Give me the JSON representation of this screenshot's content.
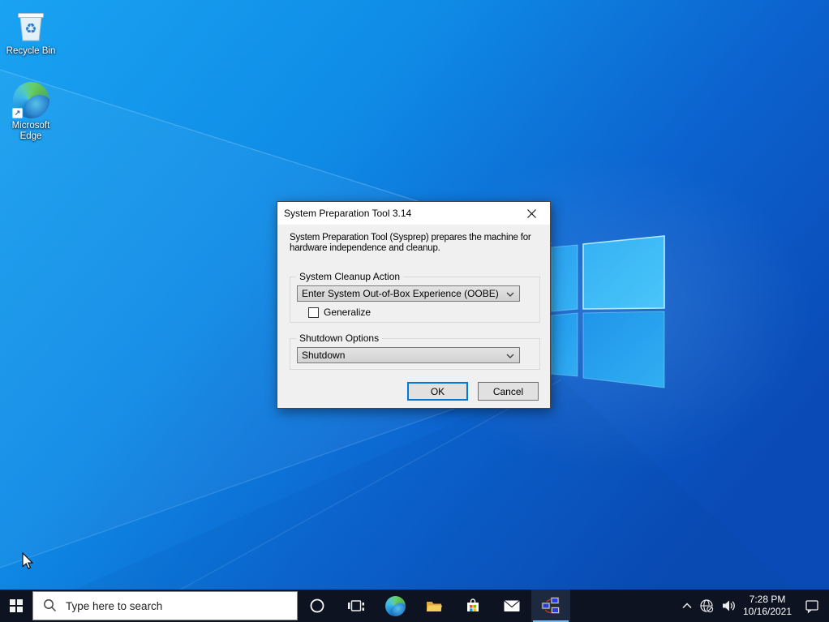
{
  "desktop": {
    "icons": [
      {
        "label": "Recycle Bin"
      },
      {
        "label": "Microsoft Edge"
      }
    ]
  },
  "dialog": {
    "title": "System Preparation Tool 3.14",
    "description_line1": "System Preparation Tool (Sysprep) prepares the machine for",
    "description_line2": "hardware independence and cleanup.",
    "cleanup_group": {
      "label": "System Cleanup Action",
      "dropdown_value": "Enter System Out-of-Box Experience (OOBE)",
      "checkbox_label": "Generalize",
      "checkbox_checked": false
    },
    "shutdown_group": {
      "label": "Shutdown Options",
      "dropdown_value": "Shutdown"
    },
    "buttons": {
      "ok": "OK",
      "cancel": "Cancel"
    }
  },
  "taskbar": {
    "search": {
      "placeholder": "Type here to search"
    },
    "apps": [
      {
        "name": "cortana"
      },
      {
        "name": "task-view"
      },
      {
        "name": "microsoft-edge"
      },
      {
        "name": "file-explorer"
      },
      {
        "name": "microsoft-store"
      },
      {
        "name": "mail"
      },
      {
        "name": "sysprep",
        "active": true
      }
    ],
    "tray": {
      "time": "7:28 PM",
      "date": "10/16/2021"
    }
  },
  "icons": {
    "shortcut_arrow": "↗"
  },
  "colors": {
    "accent_blue": "#0078d7",
    "taskbar_bg": "#0d1320",
    "active_app_underline": "#76b9ed",
    "dialog_body": "#f0f0f0",
    "titlebar_bg": "#ffffff",
    "wallpaper_light": "#1aa3f2",
    "wallpaper_dark": "#0a4cb8"
  }
}
